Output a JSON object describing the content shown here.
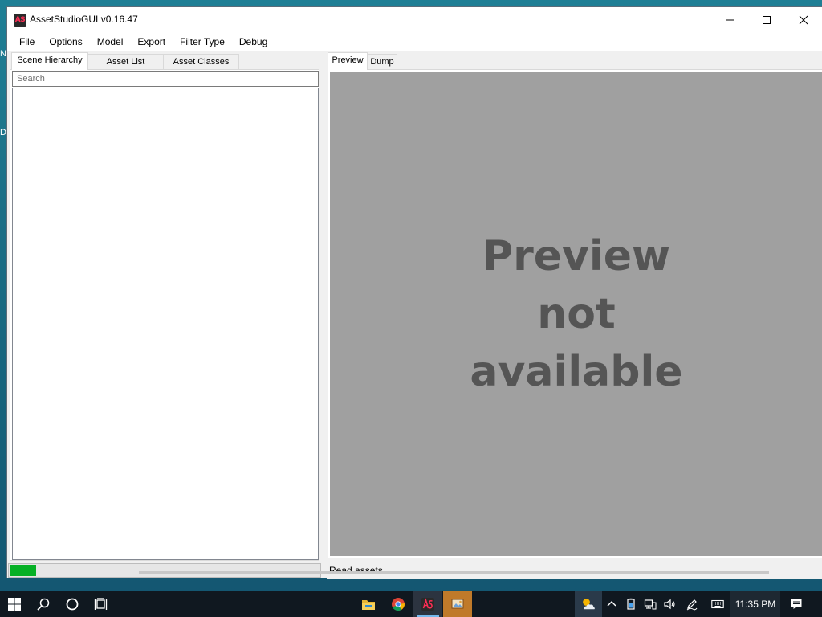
{
  "window": {
    "title": "AssetStudioGUI v0.16.47",
    "icon_label": "AS"
  },
  "menu": [
    "File",
    "Options",
    "Model",
    "Export",
    "Filter Type",
    "Debug"
  ],
  "left_tabs": [
    "Scene Hierarchy",
    "Asset List",
    "Asset Classes"
  ],
  "search": {
    "placeholder": "Search",
    "value": ""
  },
  "progress": {
    "fraction": 0.09
  },
  "right_tabs": [
    "Preview",
    "Dump"
  ],
  "preview": {
    "message_lines": [
      "Preview",
      "not",
      "available"
    ]
  },
  "status": {
    "text": "Read assets..."
  },
  "taskbar": {
    "clock": "11:35 PM",
    "pinned_apps": [
      "file-explorer-icon",
      "chrome-icon",
      "assetstudio-icon",
      "image-viewer-icon"
    ]
  },
  "colors": {
    "progress_fill": "#06b025",
    "preview_bg": "#a0a0a0",
    "preview_text": "#555555",
    "taskbar_bg": "#101820"
  }
}
